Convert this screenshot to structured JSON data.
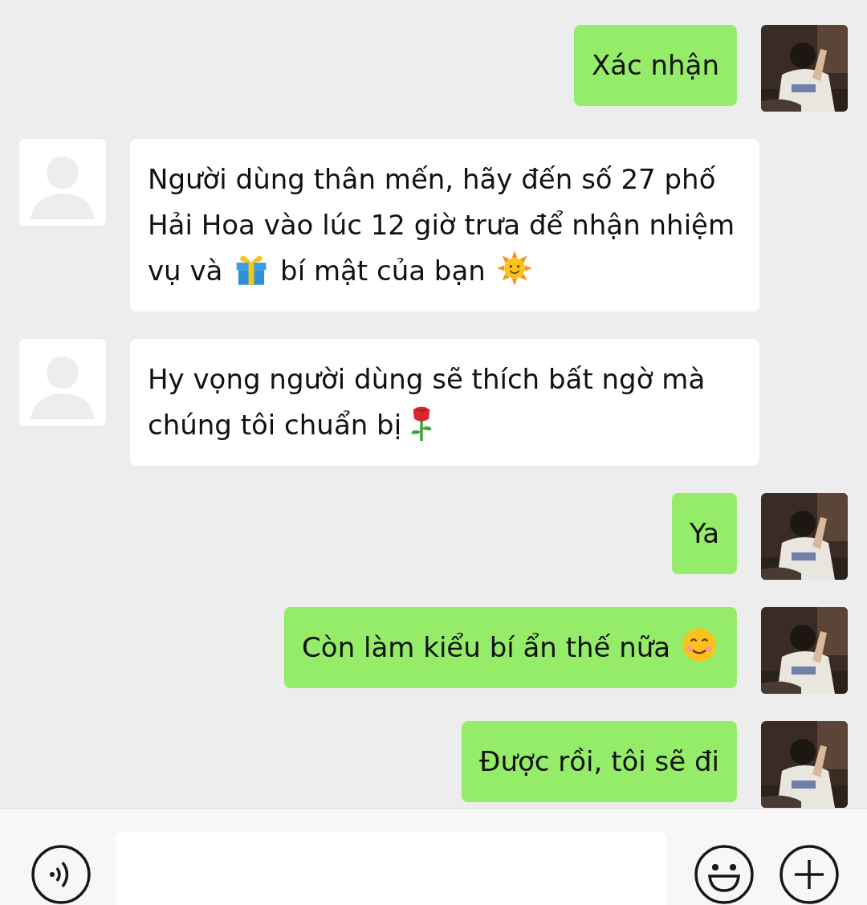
{
  "messages": [
    {
      "kind": "outgoing",
      "parts": [
        {
          "kind": "text",
          "text": "Xác nhận"
        }
      ]
    },
    {
      "kind": "incoming",
      "parts": [
        {
          "kind": "text",
          "text": "Người dùng thân mến, hãy đến số 27 phố Hải Hoa vào lúc 12 giờ trưa để nhận nhiệm vụ và "
        },
        {
          "kind": "gift"
        },
        {
          "kind": "text",
          "text": " bí mật của bạn "
        },
        {
          "kind": "sun"
        }
      ]
    },
    {
      "kind": "incoming",
      "parts": [
        {
          "kind": "text",
          "text": "Hy vọng người dùng sẽ thích bất ngờ mà chúng tôi chuẩn bị"
        },
        {
          "kind": "rose"
        }
      ]
    },
    {
      "kind": "outgoing",
      "parts": [
        {
          "kind": "text",
          "text": "Ya"
        }
      ]
    },
    {
      "kind": "outgoing",
      "parts": [
        {
          "kind": "text",
          "text": "Còn làm kiểu bí ẩn thế nữa "
        },
        {
          "kind": "smile"
        }
      ]
    },
    {
      "kind": "outgoing",
      "parts": [
        {
          "kind": "text",
          "text": "Được rồi, tôi sẽ đi"
        }
      ]
    }
  ]
}
